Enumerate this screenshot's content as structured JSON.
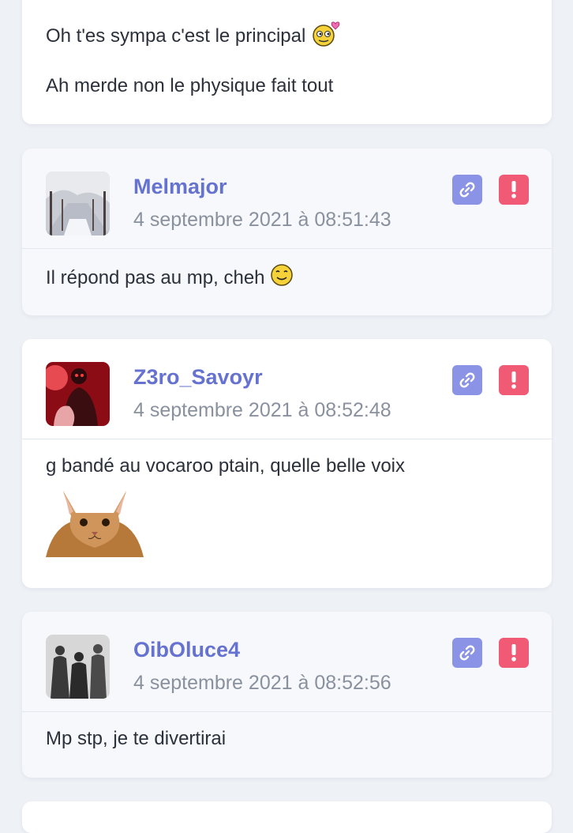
{
  "posts": [
    {
      "lines": [
        "Oh t'es sympa c'est le principal",
        "Ah merde non le physique fait tout"
      ]
    },
    {
      "author": "Melmajor",
      "date": "4 septembre 2021 à 08:51:43",
      "message": "Il répond pas au mp, cheh",
      "emoji": "smile-emoji"
    },
    {
      "author": "Z3ro_Savoyr",
      "date": "4 septembre 2021 à 08:52:48",
      "message": "g bandé au vocaroo ptain, quelle belle voix",
      "sticker": "cat-sticker"
    },
    {
      "author": "OibOluce4",
      "date": "4 septembre 2021 à 08:52:56",
      "message": "Mp stp, je te divertirai"
    }
  ],
  "icons": {
    "permalink": "link-icon",
    "report": "alert-icon"
  },
  "colors": {
    "author": "#6572cf",
    "permalink_bg": "#8b93e6",
    "report_bg": "#f05a75"
  }
}
